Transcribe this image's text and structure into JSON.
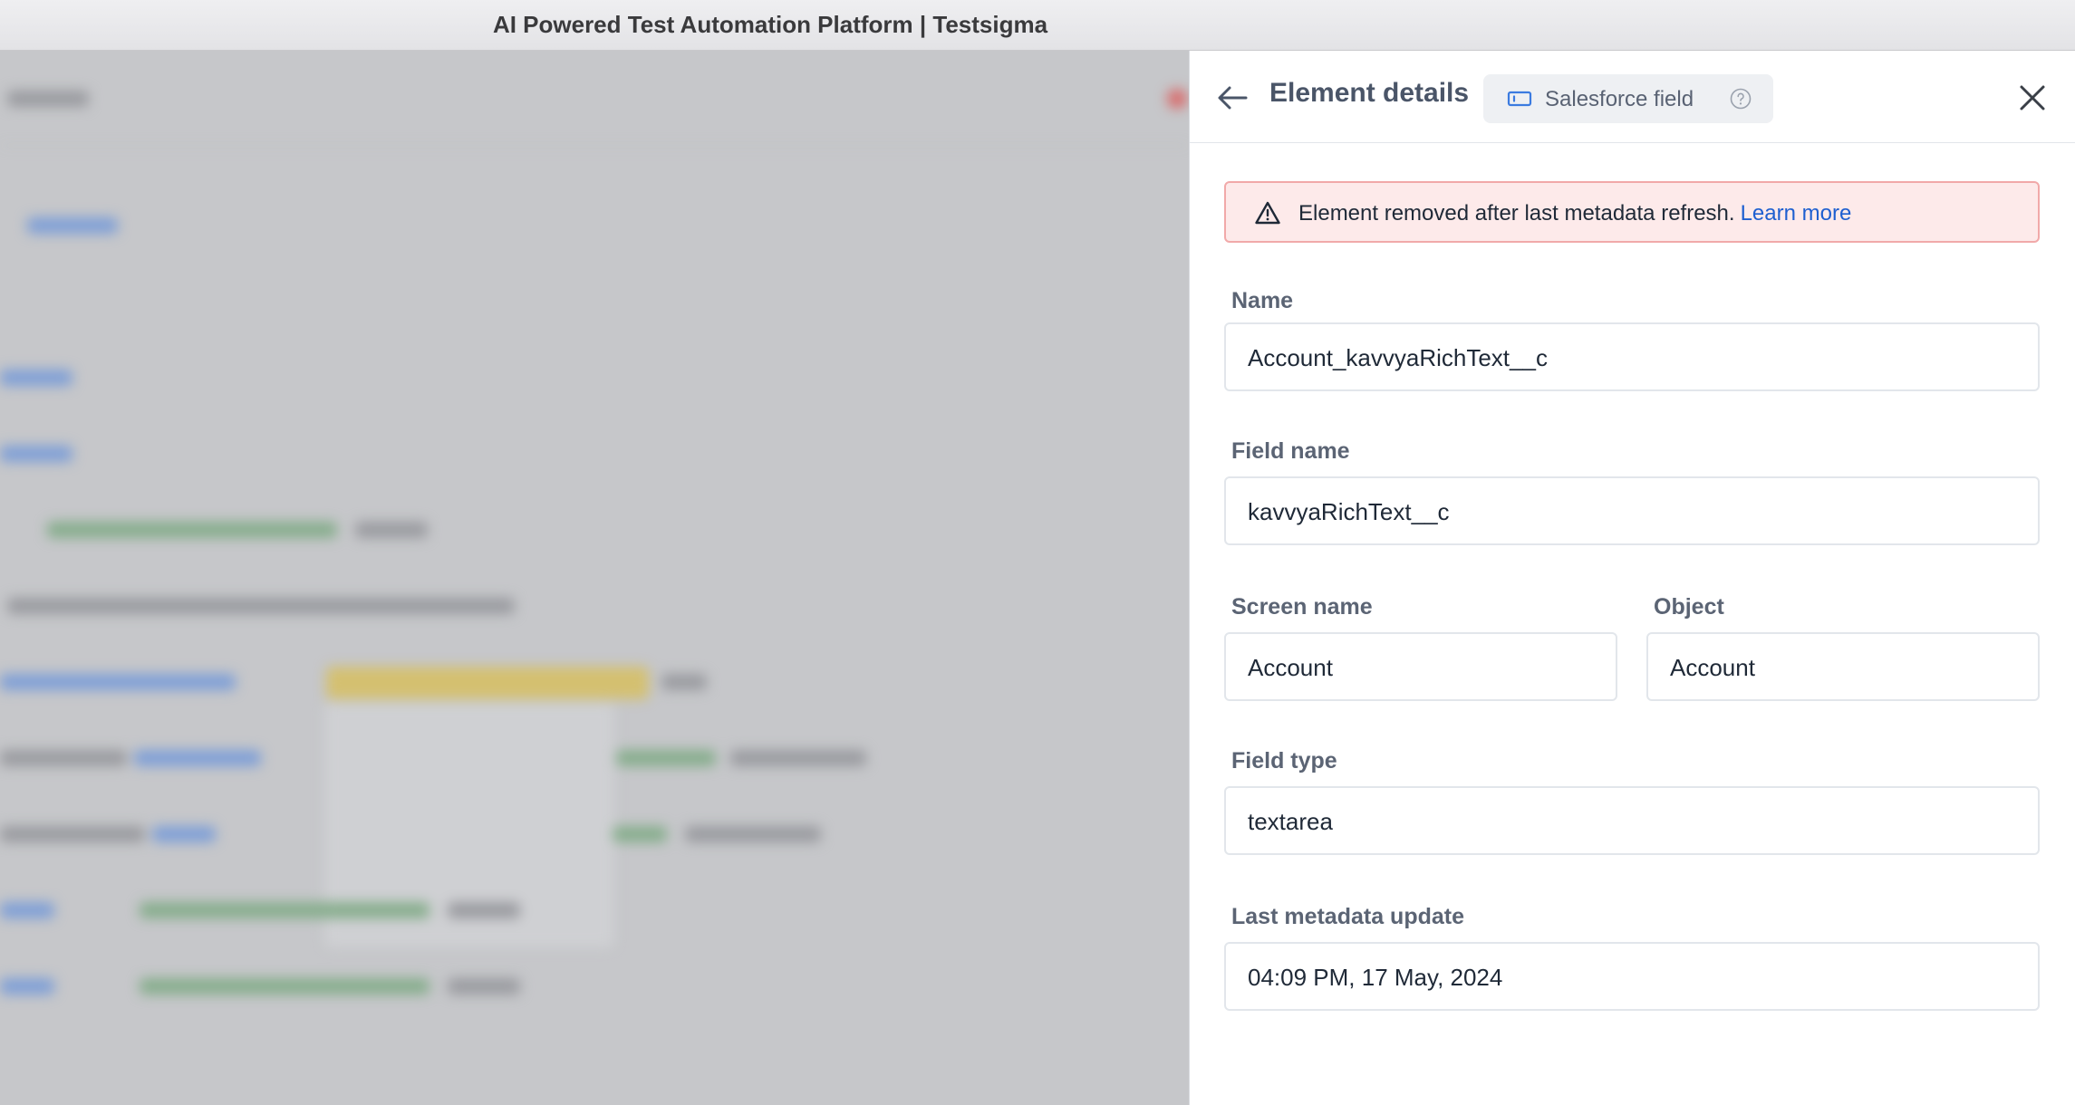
{
  "window": {
    "title": "AI Powered Test Automation Platform | Testsigma"
  },
  "panel": {
    "title": "Element details",
    "chip_label": "Salesforce field",
    "icons": {
      "back": "arrow-left-icon",
      "chip": "salesforce-field-icon",
      "help": "help-circle-icon",
      "close": "close-icon",
      "warning": "warning-triangle-icon"
    },
    "alert": {
      "message": "Element removed after last metadata refresh.",
      "link": "Learn more"
    },
    "fields": {
      "name": {
        "label": "Name",
        "value": "Account_kavvyaRichText__c"
      },
      "field_name": {
        "label": "Field name",
        "value": "kavvyaRichText__c"
      },
      "screen_name": {
        "label": "Screen name",
        "value": "Account"
      },
      "object": {
        "label": "Object",
        "value": "Account"
      },
      "field_type": {
        "label": "Field type",
        "value": "textarea"
      },
      "last_update": {
        "label": "Last metadata update",
        "value": "04:09 PM, 17 May, 2024"
      }
    }
  },
  "colors": {
    "accent": "#1e5fd0",
    "alert_bg": "#fdeaea",
    "alert_border": "#f1a9a9"
  }
}
